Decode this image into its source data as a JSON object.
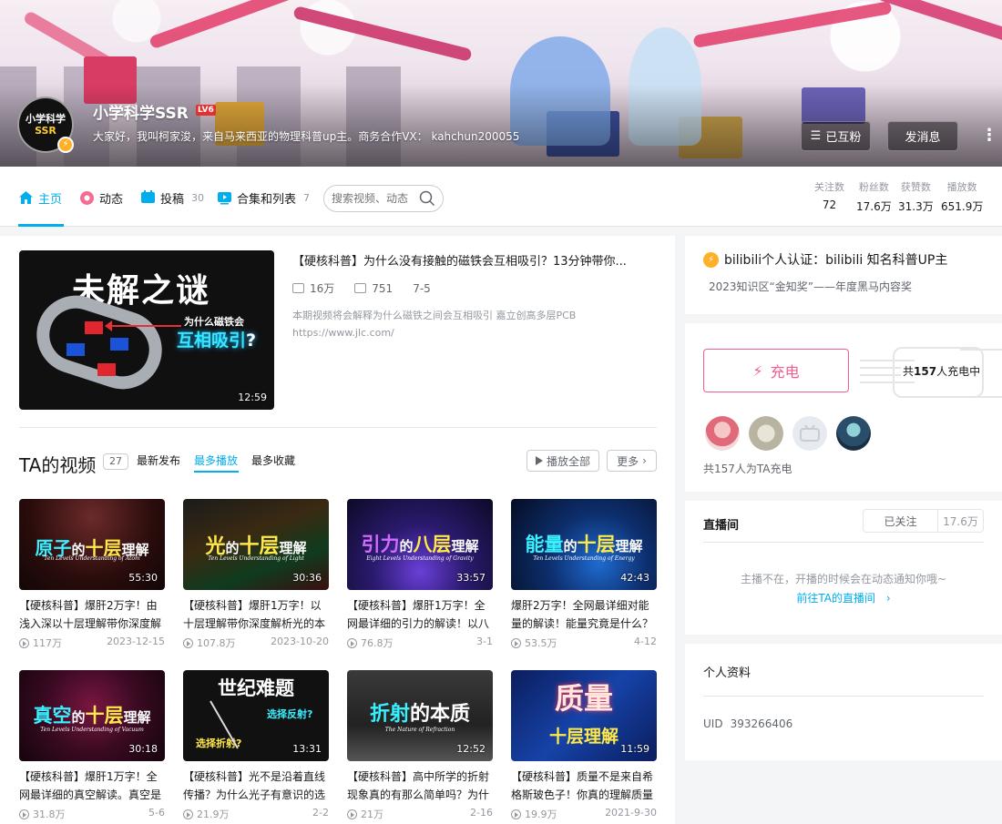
{
  "header": {
    "username": "小学科学SSR",
    "level": "LV6",
    "sign": "大家好，我叫柯家浚，来自马来西亚的物理科普up主。商务合作VX： kahchun200055",
    "avatar_line1": "小学科学",
    "avatar_line2": "SSR",
    "followed_label": "已互粉",
    "message_label": "发消息",
    "more_label": "⋮"
  },
  "nav": {
    "tabs": [
      {
        "label": "主页",
        "count": ""
      },
      {
        "label": "动态",
        "count": ""
      },
      {
        "label": "投稿",
        "count": "30"
      },
      {
        "label": "合集和列表",
        "count": "7"
      }
    ],
    "search_placeholder": "搜索视频、动态",
    "stats": [
      {
        "key": "关注数",
        "value": "72"
      },
      {
        "key": "粉丝数",
        "value": "17.6万"
      },
      {
        "key": "获赞数",
        "value": "31.3万"
      },
      {
        "key": "播放数",
        "value": "651.9万"
      }
    ]
  },
  "top_video": {
    "thumb_title": "未解之谜",
    "thumb_q1": "为什么磁铁会",
    "thumb_q2": "互相吸引",
    "thumb_q2_mark": "?",
    "duration": "12:59",
    "title": "【硬核科普】为什么没有接触的磁铁会互相吸引？13分钟带你...",
    "views": "16万",
    "comments": "751",
    "date": "7-5",
    "desc": "本期视频将会解释为什么磁铁之间会互相吸引 嘉立创高多层PCB",
    "link": "https://www.jlc.com/"
  },
  "videos_section": {
    "title": "TA的视频",
    "count": "27",
    "sort_options": [
      "最新发布",
      "最多播放",
      "最多收藏"
    ],
    "play_all": "播放全部",
    "more": "更多"
  },
  "videos": [
    {
      "big1": "原子",
      "big2": "的",
      "big3": "十层",
      "big4": "理解",
      "sub": "Ten Levels Understanding of Atom",
      "duration": "55:30",
      "title": "【硬核科普】爆肝2万字！由浅入深以十层理解带你深度解",
      "views": "117万",
      "date": "2023-12-15"
    },
    {
      "big1": "光",
      "big2": "的",
      "big3": "十层",
      "big4": "理解",
      "sub": "Ten Levels Understanding of Light",
      "duration": "30:36",
      "title": "【硬核科普】爆肝1万字！以十层理解带你深度解析光的本",
      "views": "107.8万",
      "date": "2023-10-20"
    },
    {
      "big1": "引力",
      "big2": "的",
      "big3": "八层",
      "big4": "理解",
      "sub": "Eight Levels Understanding of Gravity",
      "duration": "33:57",
      "title": "【硬核科普】爆肝1万字！全网最详细的引力的解读！以八",
      "views": "76.8万",
      "date": "3-1"
    },
    {
      "big1": "能量",
      "big2": "的",
      "big3": "十层",
      "big4": "理解",
      "sub": "Ten Levels Understanding of Energy",
      "duration": "42:43",
      "title": "爆肝2万字！全网最详细对能量的解读！能量究竟是什么？",
      "views": "53.5万",
      "date": "4-12"
    },
    {
      "big1": "真空",
      "big2": "的",
      "big3": "十层",
      "big4": "理解",
      "sub": "Ten Levels Understanding of Vacuum",
      "duration": "30:18",
      "title": "【硬核科普】爆肝1万字！全网最详细的真空解读。真空是",
      "views": "31.8万",
      "date": "5-6"
    },
    {
      "big1": "世纪难题",
      "big2": "选择反射?",
      "big3": "选择折射?",
      "big4": "",
      "sub": "",
      "duration": "13:31",
      "title": "【硬核科普】光不是沿着直线传播？为什么光子有意识的选",
      "views": "21.9万",
      "date": "2-2"
    },
    {
      "big1": "折射",
      "big2": "的本质",
      "big3": "",
      "big4": "",
      "sub": "The Nature of Refraction",
      "duration": "12:52",
      "title": "【硬核科普】高中所学的折射现象真的有那么简单吗？为什",
      "views": "21万",
      "date": "2-16"
    },
    {
      "big1": "质量",
      "big2": "十层理解",
      "big3": "",
      "big4": "",
      "sub": "",
      "duration": "11:59",
      "title": "【硬核科普】质量不是来自希格斯玻色子！你真的理解质量",
      "views": "19.9万",
      "date": "2021-9-30"
    }
  ],
  "auth": {
    "line1": "bilibili个人认证：bilibili 知名科普UP主",
    "line2": "2023知识区“金知奖”——年度黑马内容奖"
  },
  "charge": {
    "button_label": "充电",
    "count_prefix": "共",
    "count": "157",
    "count_suffix": "人充电中",
    "footer": "共157人为TA充电"
  },
  "live": {
    "title": "直播间",
    "follow_label": "已关注",
    "follow_count": "17.6万",
    "status": "主播不在，开播的时候会在动态通知你哦~",
    "link": "前往TA的直播间"
  },
  "profile": {
    "title": "个人资料",
    "uid_label": "UID",
    "uid": "393266406"
  },
  "colors": {
    "accent": "#00aeec",
    "charge": "#f25d8e",
    "level_badge": "#e52e2e"
  }
}
